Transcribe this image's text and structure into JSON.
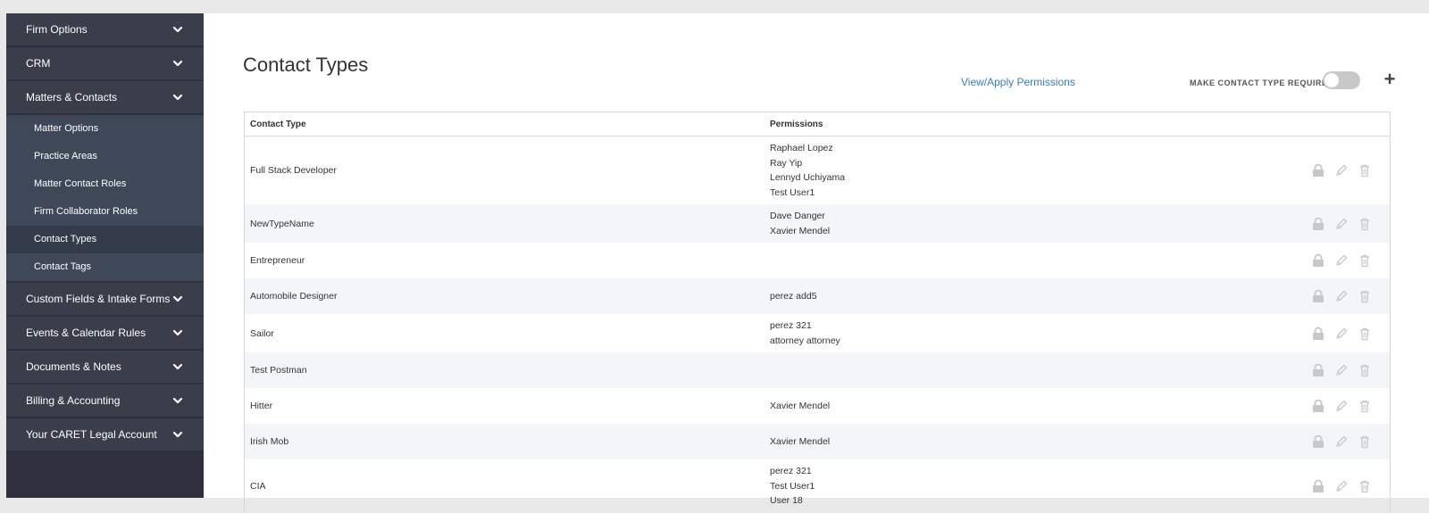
{
  "sidebar": {
    "groups_top": [
      {
        "label": "Firm Options"
      },
      {
        "label": "CRM"
      },
      {
        "label": "Matters & Contacts"
      }
    ],
    "sub_items": [
      {
        "label": "Matter Options"
      },
      {
        "label": "Practice Areas"
      },
      {
        "label": "Matter Contact Roles"
      },
      {
        "label": "Firm Collaborator Roles"
      },
      {
        "label": "Contact Types",
        "active": true
      },
      {
        "label": "Contact Tags"
      }
    ],
    "groups_bottom": [
      {
        "label": "Custom Fields & Intake Forms"
      },
      {
        "label": "Events & Calendar Rules"
      },
      {
        "label": "Documents & Notes"
      },
      {
        "label": "Billing & Accounting"
      },
      {
        "label": "Your CARET Legal Account"
      }
    ]
  },
  "main": {
    "title": "Contact Types",
    "permissions_link": "View/Apply Permissions",
    "required_label": "MAKE CONTACT TYPE REQUIRED",
    "required_toggle": false,
    "add_icon": "plus-icon"
  },
  "table": {
    "headers": {
      "type": "Contact Type",
      "permissions": "Permissions"
    },
    "rows": [
      {
        "type": "Full Stack Developer",
        "permissions": [
          "Raphael Lopez",
          "Ray Yip",
          "Lennyd Uchiyama",
          "Test User1"
        ]
      },
      {
        "type": "NewTypeName",
        "permissions": [
          "Dave Danger",
          "Xavier Mendel"
        ]
      },
      {
        "type": "Entrepreneur",
        "permissions": []
      },
      {
        "type": "Automobile Designer",
        "permissions": [
          "perez add5"
        ]
      },
      {
        "type": "Sailor",
        "permissions": [
          "perez 321",
          "attorney attorney"
        ]
      },
      {
        "type": "Test Postman",
        "permissions": []
      },
      {
        "type": "Hitter",
        "permissions": [
          "Xavier Mendel"
        ]
      },
      {
        "type": "Irish Mob",
        "permissions": [
          "Xavier Mendel"
        ]
      },
      {
        "type": "CIA",
        "permissions": [
          "perez 321",
          "Test User1",
          "User 18"
        ]
      }
    ],
    "action_icons": [
      "lock-icon",
      "pencil-icon",
      "trash-icon"
    ]
  },
  "colors": {
    "sidebar_bg": "#2f2f3d",
    "group_bg": "#3a3d4a",
    "sub_bg": "#3e4858",
    "link": "#3a7bc8",
    "row_alt": "#f2f6f8",
    "icon": "#c4c4c4"
  }
}
